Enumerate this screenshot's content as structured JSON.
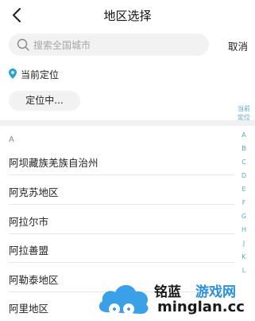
{
  "header": {
    "title": "地区选择",
    "back_icon": "chevron-left-icon"
  },
  "search": {
    "placeholder": "搜索全国城市",
    "icon": "search-icon",
    "cancel_label": "取消"
  },
  "location": {
    "label": "当前定位",
    "icon": "location-pin-icon",
    "button_label": "定位中...",
    "accent_color": "#29a3d4"
  },
  "list": {
    "section": "A",
    "items": [
      "阿坝藏族羌族自治州",
      "阿克苏地区",
      "阿拉尔市",
      "阿拉善盟",
      "阿勒泰地区",
      "阿里地区"
    ]
  },
  "index_bar": {
    "current_label": "当前定位",
    "letters": [
      "A",
      "B",
      "C",
      "D",
      "E",
      "F",
      "G",
      "H",
      "J",
      "K",
      "L"
    ]
  },
  "watermark": {
    "brand": "铭蓝",
    "brand2": "游戏网",
    "url": "minglan.cc"
  }
}
